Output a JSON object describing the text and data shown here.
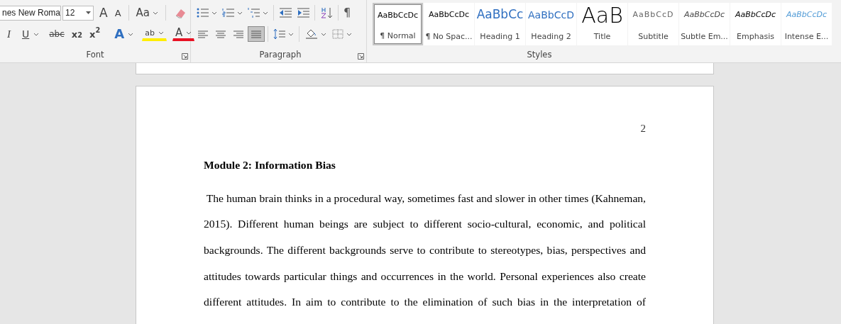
{
  "ribbon": {
    "font_group": {
      "label": "Font",
      "font_name": "nes New Roma",
      "font_size": "12",
      "grow_font": "A",
      "shrink_font": "A",
      "change_case": "Aa",
      "italic": "I",
      "underline": "U",
      "strikethrough": "abc",
      "subscript": "x$_{2}$",
      "superscript": "x$^{2}$",
      "text_effects": "A",
      "highlight": "ab",
      "font_color": "A"
    },
    "paragraph_group": {
      "label": "Paragraph",
      "show_marks": "¶",
      "alignment_buttons": [
        {
          "selected": false
        },
        {
          "selected": false
        },
        {
          "selected": false
        },
        {
          "selected": true
        }
      ]
    },
    "styles_group": {
      "label": "Styles",
      "items": [
        {
          "kind": "normal",
          "preview": "AaBbCcDc",
          "label": "¶ Normal",
          "selected": true
        },
        {
          "kind": "normal",
          "preview": "AaBbCcDc",
          "label": "¶ No Spac...",
          "selected": false
        },
        {
          "kind": "heading1",
          "preview": "AaBbCc",
          "label": "Heading 1",
          "selected": false
        },
        {
          "kind": "heading2",
          "preview": "AaBbCcD",
          "label": "Heading 2",
          "selected": false
        },
        {
          "kind": "title",
          "preview": "AaB",
          "label": "Title",
          "selected": false
        },
        {
          "kind": "subtitle",
          "preview": "AaBbCcD",
          "label": "Subtitle",
          "selected": false
        },
        {
          "kind": "subtle",
          "preview": "AaBbCcDc",
          "label": "Subtle Em...",
          "selected": false
        },
        {
          "kind": "emphasis",
          "preview": "AaBbCcDc",
          "label": "Emphasis",
          "selected": false
        },
        {
          "kind": "intense",
          "preview": "AaBbCcDc",
          "label": "Intense E...",
          "selected": false
        }
      ]
    }
  },
  "document": {
    "page_number": "2",
    "heading": "Module 2: Information Bias",
    "paragraph_lines": [
      " The human brain thinks in a procedural way, sometimes fast and slower in other times (Kahneman,",
      "2015). Different human beings are subject to different socio-cultural, economic, and political",
      "backgrounds. The different backgrounds serve to contribute to stereotypes, bias, perspectives and",
      "attitudes towards particular things and occurrences in the world. Personal experiences also create",
      "different attitudes. In aim to contribute to the elimination of such bias in the interpretation of"
    ]
  }
}
